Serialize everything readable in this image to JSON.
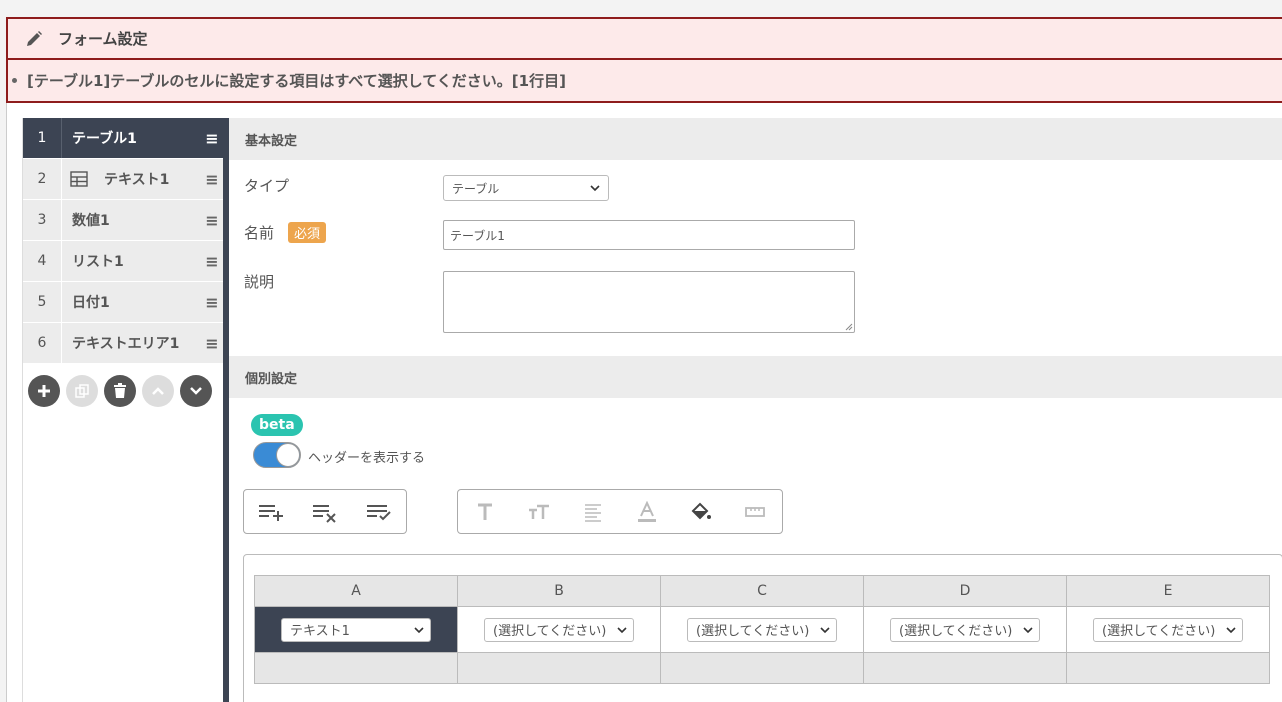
{
  "header": {
    "title": "フォーム設定"
  },
  "error": {
    "message": "[テーブル1]テーブルのセルに設定する項目はすべて選択してください。[1行目]"
  },
  "sidebar": {
    "items": [
      {
        "num": "1",
        "label": "テーブル1",
        "active": true
      },
      {
        "num": "2",
        "label": "テキスト1",
        "icon": "table-icon"
      },
      {
        "num": "3",
        "label": "数値1"
      },
      {
        "num": "4",
        "label": "リスト1"
      },
      {
        "num": "5",
        "label": "日付1"
      },
      {
        "num": "6",
        "label": "テキストエリア1"
      }
    ],
    "tools": [
      "plus-icon",
      "copy-icon",
      "trash-icon",
      "chevron-up-icon",
      "chevron-down-icon"
    ]
  },
  "basic": {
    "section_title": "基本設定",
    "type_label": "タイプ",
    "type_value": "テーブル",
    "name_label": "名前",
    "required_badge": "必須",
    "name_value": "テーブル1",
    "desc_label": "説明"
  },
  "individual": {
    "section_title": "個別設定",
    "beta": "beta",
    "header_toggle_label": "ヘッダーを表示する",
    "header_toggle_on": true
  },
  "table": {
    "columns": [
      "A",
      "B",
      "C",
      "D",
      "E"
    ],
    "row_values": [
      "テキスト1",
      "(選択してください)",
      "(選択してください)",
      "(選択してください)",
      "(選択してください)"
    ]
  },
  "colors": {
    "accent": "#3c4453",
    "error_border": "#8e1c1c",
    "error_bg": "#fdeaea",
    "required": "#eda54d",
    "beta": "#2bc4b0",
    "toggle": "#3a8bd5"
  }
}
